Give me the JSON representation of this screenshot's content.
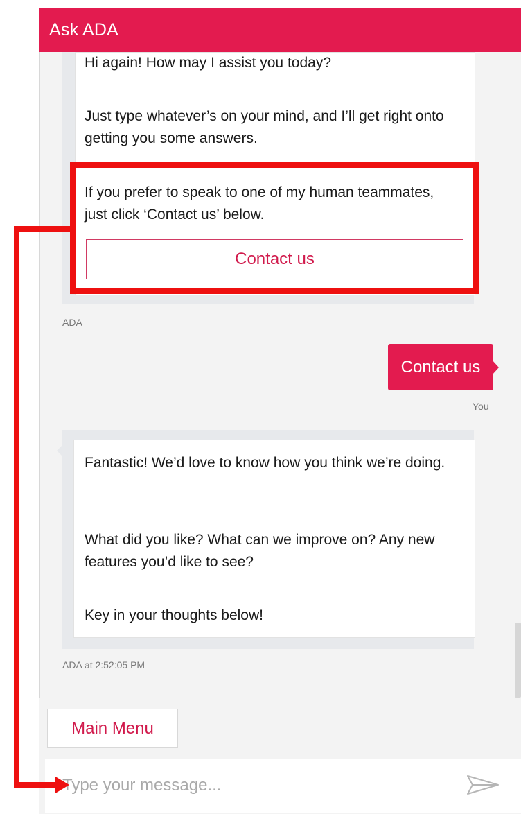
{
  "header": {
    "title": "Ask ADA",
    "color": "#e31b4f"
  },
  "conversation": {
    "first_bot_group": {
      "messages": [
        "Hi again! How may I assist you today?",
        "Just type whatever’s on your mind, and I’ll get right onto getting you some answers.",
        "If you prefer to speak to one of my human teammates, just click ‘Contact us’ below."
      ],
      "button_label": "Contact us",
      "sender": "ADA"
    },
    "user_message": {
      "text": "Contact us",
      "sender": "You"
    },
    "second_bot_group": {
      "messages": [
        "Fantastic! We’d love to know how you think we’re doing.",
        "What did you like? What can we improve on? Any new features you’d like to see?",
        "Key in your thoughts below!"
      ],
      "sender_timestamp": "ADA at 2:52:05 PM"
    }
  },
  "footer": {
    "main_menu_label": "Main Menu",
    "input_placeholder": "Type your message...",
    "send_icon": "send-icon"
  },
  "annotation": {
    "highlight_color": "#ee1010"
  }
}
